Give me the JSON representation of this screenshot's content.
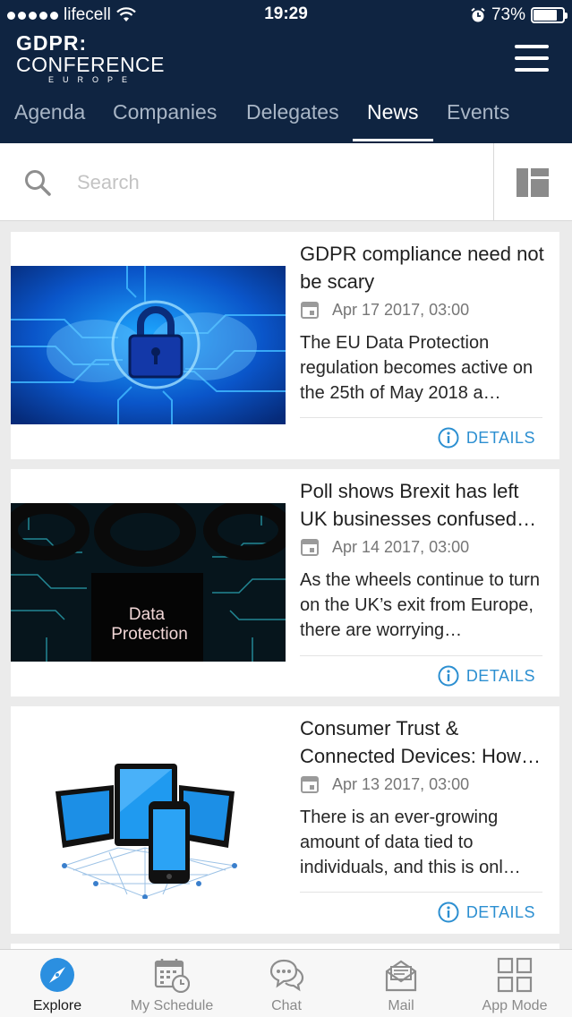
{
  "status_bar": {
    "carrier": "lifecell",
    "time": "19:29",
    "battery": "73%"
  },
  "header": {
    "logo": {
      "line1": "GDPR:",
      "line2": "CONFERENCE",
      "line3": "EUROPE"
    },
    "tabs": [
      {
        "label": "Agenda"
      },
      {
        "label": "Companies"
      },
      {
        "label": "Delegates"
      },
      {
        "label": "News"
      },
      {
        "label": "Events"
      }
    ],
    "active_tab": "News"
  },
  "search": {
    "placeholder": "Search",
    "value": ""
  },
  "articles": [
    {
      "title": "GDPR compliance need not be scary",
      "date": "Apr 17 2017, 03:00",
      "excerpt": "The EU Data Protection regulation becomes active on the 25th of May 2018 a…",
      "details_label": "DETAILS"
    },
    {
      "title": "Poll shows Brexit has left UK businesses confused…",
      "date": "Apr 14 2017, 03:00",
      "excerpt": "As the wheels continue to turn on the UK’s exit from Europe, there are worrying…",
      "details_label": "DETAILS",
      "image_text": {
        "line1": "Data",
        "line2": "Protection"
      }
    },
    {
      "title": "Consumer Trust & Connected Devices: How…",
      "date": "Apr 13 2017, 03:00",
      "excerpt": "There is an ever-growing amount of data tied to individuals, and this is onl…",
      "details_label": "DETAILS"
    }
  ],
  "bottom_nav": [
    {
      "label": "Explore",
      "icon": "compass-icon",
      "active": true
    },
    {
      "label": "My Schedule",
      "icon": "calendar-clock-icon",
      "active": false
    },
    {
      "label": "Chat",
      "icon": "chat-bubbles-icon",
      "active": false
    },
    {
      "label": "Mail",
      "icon": "mail-icon",
      "active": false
    },
    {
      "label": "App Mode",
      "icon": "grid-icon",
      "active": false
    }
  ],
  "colors": {
    "header_bg": "#0f2441",
    "accent": "#2c8fd1",
    "inactive_tab": "#a9b6c6"
  }
}
